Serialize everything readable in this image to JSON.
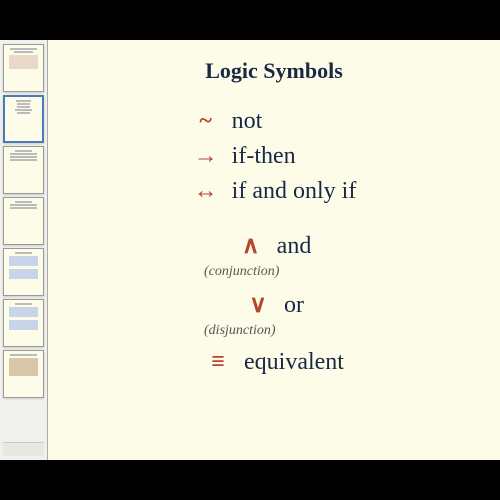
{
  "slide": {
    "title": "Logic Symbols",
    "rows": [
      {
        "symbol": "~",
        "meaning": "not"
      },
      {
        "symbol": "→",
        "meaning": "if-then"
      },
      {
        "symbol": "↔",
        "meaning": "if and only if"
      }
    ],
    "rows2": [
      {
        "symbol": "∧",
        "meaning": "and",
        "note": "(conjunction)"
      },
      {
        "symbol": "∨",
        "meaning": "or",
        "note": "(disjunction)"
      },
      {
        "symbol": "≡",
        "meaning": "equivalent"
      }
    ]
  }
}
